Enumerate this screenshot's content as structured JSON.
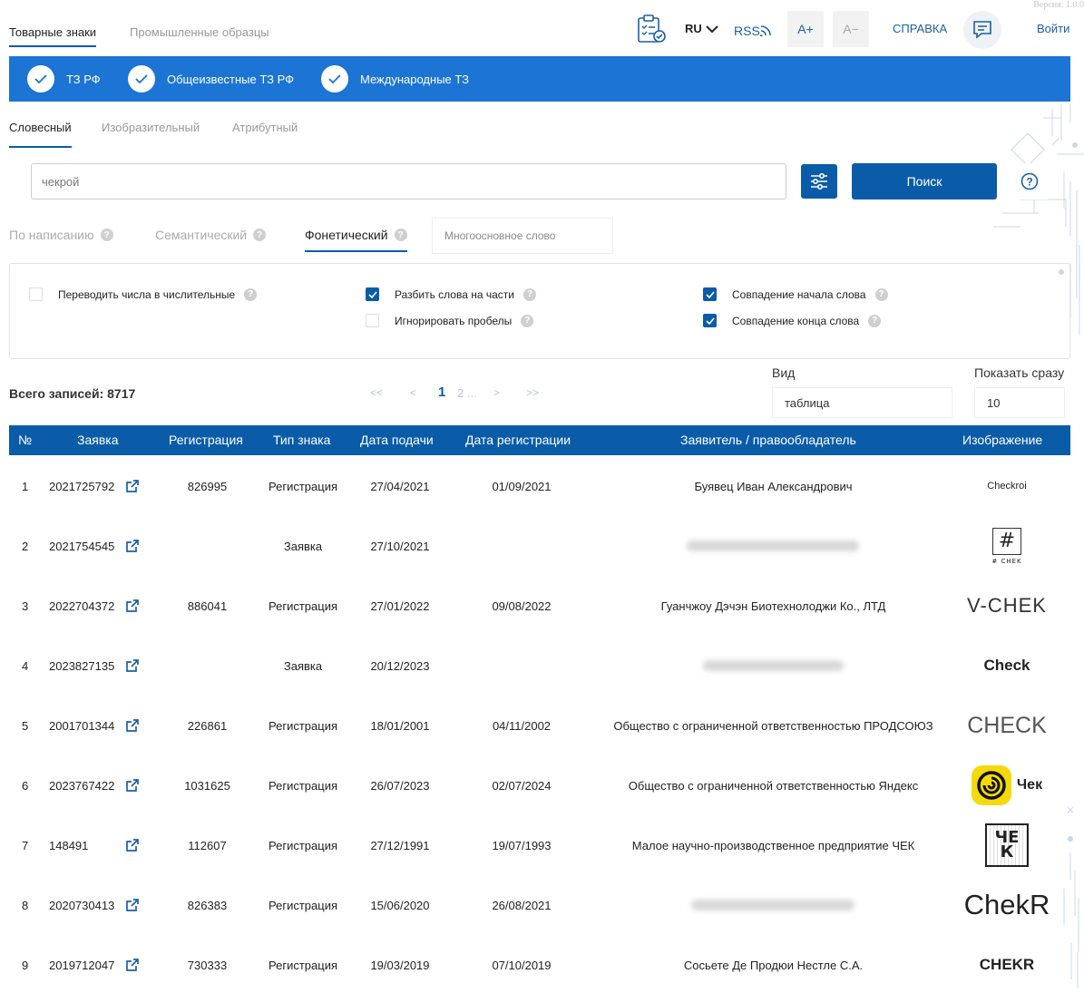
{
  "version": "Версия: 1.0.0",
  "top_tabs": [
    "Товарные знаки",
    "Промышленные образцы"
  ],
  "header": {
    "lang": "RU",
    "rss": "RSS",
    "font_inc": "A+",
    "font_dec": "A−",
    "help": "СПРАВКА",
    "login": "Войти"
  },
  "bluebar": [
    "ТЗ РФ",
    "Общеизвестные ТЗ РФ",
    "Международные ТЗ"
  ],
  "search_tabs": [
    "Словесный",
    "Изобразительный",
    "Атрибутный"
  ],
  "search": {
    "value": "чекрой",
    "button": "Поиск"
  },
  "modes": [
    "По написанию",
    "Семантический",
    "Фонетический"
  ],
  "multiword": "Многоосновное слово",
  "options": {
    "numbers": "Переводить числа в числительные",
    "split": "Разбить слова на части",
    "ignore_spaces": "Игнорировать пробелы",
    "start_match": "Совпадение начала слова",
    "end_match": "Совпадение конца слова"
  },
  "total": "Всего записей: 8717",
  "pager": {
    "first": "<<",
    "prev": "<",
    "current": "1",
    "next_pages": "2 ...",
    "next": ">",
    "last": ">>"
  },
  "view": {
    "label": "Вид",
    "value": "таблица"
  },
  "show": {
    "label": "Показать сразу",
    "value": "10"
  },
  "columns": [
    "№",
    "Заявка",
    "Регистрация",
    "Тип знака",
    "Дата подачи",
    "Дата регистрации",
    "Заявитель / правообладатель",
    "Изображение"
  ],
  "rows": [
    {
      "n": "1",
      "app": "2021725792",
      "reg": "826995",
      "type": "Регистрация",
      "filed": "27/04/2021",
      "regdate": "01/09/2021",
      "owner": "Буявец Иван Александрович",
      "img": "Checkroi"
    },
    {
      "n": "2",
      "app": "2021754545",
      "reg": "",
      "type": "Заявка",
      "filed": "27/10/2021",
      "regdate": "",
      "owner": "",
      "img": "#",
      "img_sub": "# CHEK"
    },
    {
      "n": "3",
      "app": "2022704372",
      "reg": "886041",
      "type": "Регистрация",
      "filed": "27/01/2022",
      "regdate": "09/08/2022",
      "owner": "Гуанчжоу Дэчэн Биотехнолоджи Ко., ЛТД",
      "img": "V-CHEK"
    },
    {
      "n": "4",
      "app": "2023827135",
      "reg": "",
      "type": "Заявка",
      "filed": "20/12/2023",
      "regdate": "",
      "owner": "",
      "img": "Check"
    },
    {
      "n": "5",
      "app": "2001701344",
      "reg": "226861",
      "type": "Регистрация",
      "filed": "18/01/2001",
      "regdate": "04/11/2002",
      "owner": "Общество с ограниченной ответственностью ПРОДСОЮЗ",
      "img": "CHECK"
    },
    {
      "n": "6",
      "app": "2023767422",
      "reg": "1031625",
      "type": "Регистрация",
      "filed": "26/07/2023",
      "regdate": "02/07/2024",
      "owner": "Общество с ограниченной ответственностью Яндекс",
      "img": "Чек"
    },
    {
      "n": "7",
      "app": "148491",
      "reg": "112607",
      "type": "Регистрация",
      "filed": "27/12/1991",
      "regdate": "19/07/1993",
      "owner": "Малое научно-производственное предприятие ЧЕК",
      "img": "ЧЕК"
    },
    {
      "n": "8",
      "app": "2020730413",
      "reg": "826383",
      "type": "Регистрация",
      "filed": "15/06/2020",
      "regdate": "26/08/2021",
      "owner": "",
      "img": "ChekR"
    },
    {
      "n": "9",
      "app": "2019712047",
      "reg": "730333",
      "type": "Регистрация",
      "filed": "19/03/2019",
      "regdate": "07/10/2019",
      "owner": "Сосьете Де Продюи Нестле С.А.",
      "img": "CHEKR"
    }
  ],
  "colors": {
    "primary": "#0a5ca8",
    "bar": "#1c74d4"
  }
}
